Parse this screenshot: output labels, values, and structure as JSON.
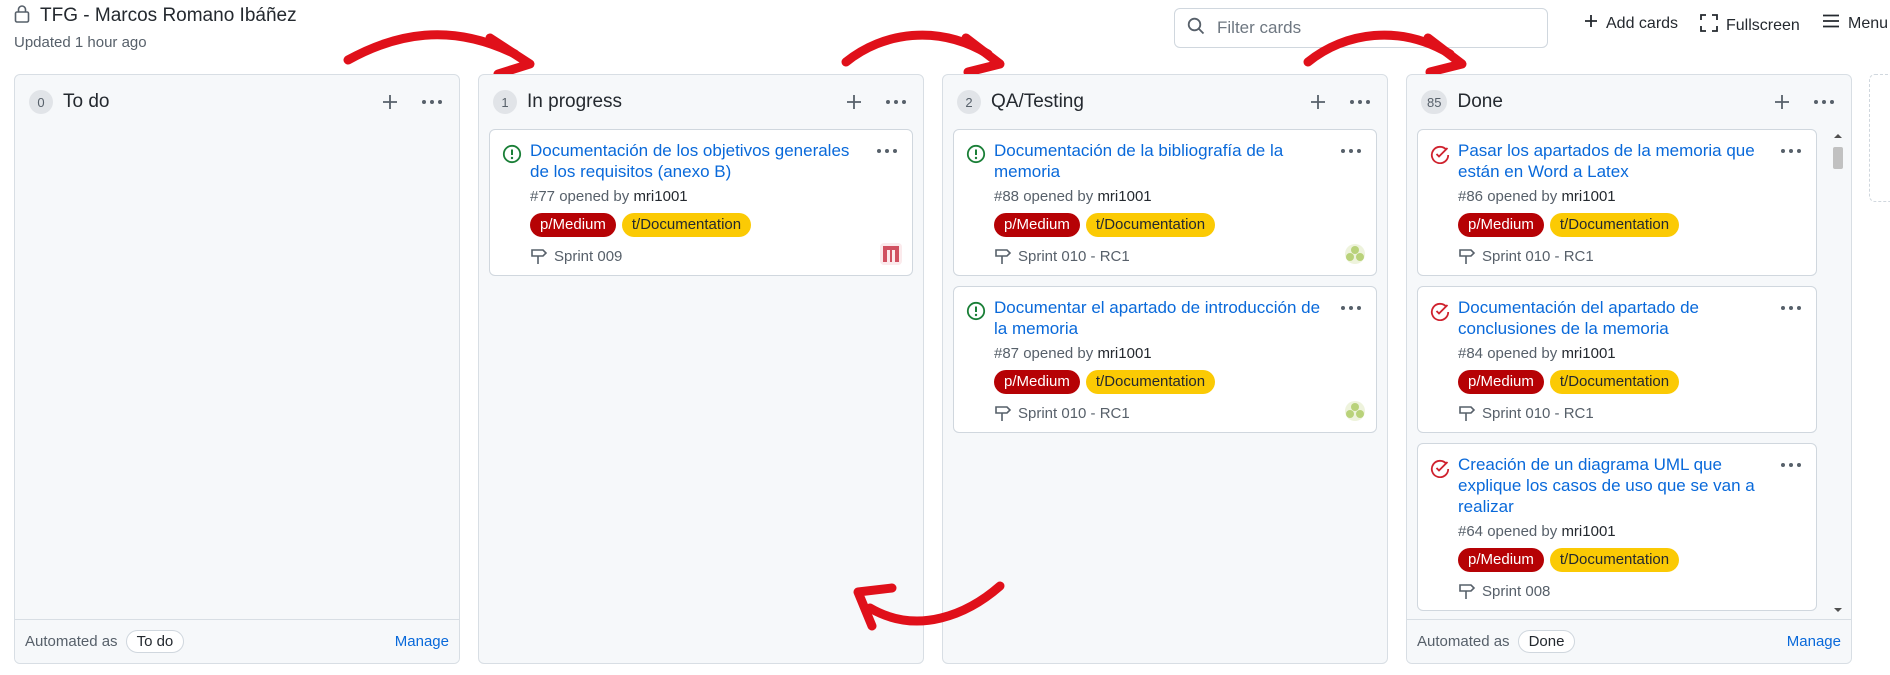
{
  "header": {
    "title": "TFG - Marcos Romano Ibáñez",
    "updated": "Updated 1 hour ago",
    "filter_placeholder": "Filter cards",
    "add_cards": "Add cards",
    "fullscreen": "Fullscreen",
    "menu": "Menu"
  },
  "columns": [
    {
      "name": "To do",
      "count": "0",
      "footer_prefix": "Automated as",
      "automation": "To do",
      "manage": "Manage",
      "cards": []
    },
    {
      "name": "In progress",
      "count": "1",
      "cards": [
        {
          "title": "Documentación de los objetivos generales de los requisitos (anexo B)",
          "number": "#77 opened by",
          "author": "mri1001",
          "labels": [
            "p/Medium",
            "t/Documentation"
          ],
          "milestone": "Sprint 009",
          "state": "open",
          "avatar_color": "#d05060"
        }
      ]
    },
    {
      "name": "QA/Testing",
      "count": "2",
      "cards": [
        {
          "title": "Documentación de la bibliografía de la memoria",
          "number": "#88 opened by",
          "author": "mri1001",
          "labels": [
            "p/Medium",
            "t/Documentation"
          ],
          "milestone": "Sprint 010 - RC1",
          "state": "open",
          "avatar_color": "#b9d27a"
        },
        {
          "title": "Documentar el apartado de introducción de la memoria",
          "number": "#87 opened by",
          "author": "mri1001",
          "labels": [
            "p/Medium",
            "t/Documentation"
          ],
          "milestone": "Sprint 010 - RC1",
          "state": "open",
          "avatar_color": "#b9d27a"
        }
      ]
    },
    {
      "name": "Done",
      "count": "85",
      "footer_prefix": "Automated as",
      "automation": "Done",
      "manage": "Manage",
      "cards": [
        {
          "title": "Pasar los apartados de la memoria que están en Word a Latex",
          "number": "#86 opened by",
          "author": "mri1001",
          "labels": [
            "p/Medium",
            "t/Documentation"
          ],
          "milestone": "Sprint 010 - RC1",
          "state": "closed"
        },
        {
          "title": "Documentación del apartado de conclusiones de la memoria",
          "number": "#84 opened by",
          "author": "mri1001",
          "labels": [
            "p/Medium",
            "t/Documentation"
          ],
          "milestone": "Sprint 010 - RC1",
          "state": "closed"
        },
        {
          "title": "Creación de un diagrama UML que explique los casos de uso que se van a realizar",
          "number": "#64 opened by",
          "author": "mri1001",
          "labels": [
            "p/Medium",
            "t/Documentation"
          ],
          "milestone": "Sprint 008",
          "state": "closed"
        }
      ]
    }
  ],
  "colors": {
    "link": "#0969da",
    "label_priority": "#b60205",
    "label_type": "#fbca04",
    "open_icon": "#1a7f37",
    "closed_icon": "#cf222e",
    "arrow": "#e0101a"
  },
  "icons": {
    "lock": "lock-icon",
    "search": "search-icon",
    "plus": "plus-icon",
    "fullscreen": "fullscreen-icon",
    "menu": "hamburger-icon",
    "kebab": "kebab-icon",
    "milestone": "milestone-icon",
    "open_issue": "issue-open-icon",
    "closed_issue": "issue-closed-icon"
  }
}
